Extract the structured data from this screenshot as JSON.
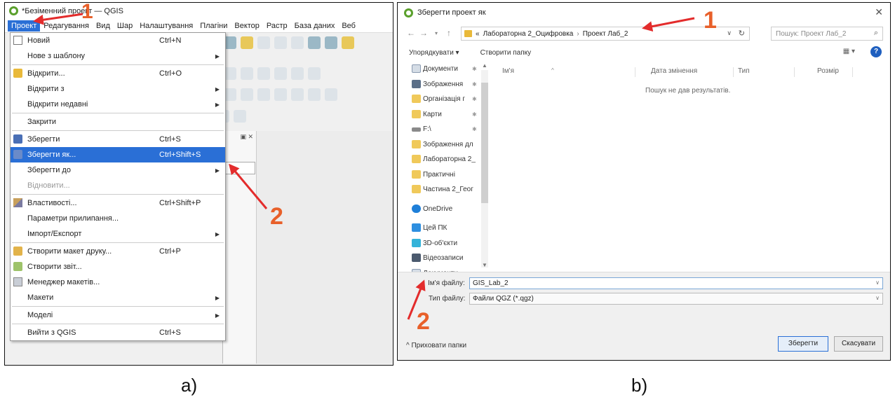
{
  "panel_a": {
    "window_title": "*Безіменний проект — QGIS",
    "menubar": [
      "Проект",
      "Редагування",
      "Вид",
      "Шар",
      "Налаштування",
      "Плагіни",
      "Вектор",
      "Растр",
      "База даних",
      "Веб"
    ],
    "menu_items": [
      {
        "label": "Новий",
        "shortcut": "Ctrl+N",
        "icon": "new-document-icon"
      },
      {
        "label": "Нове з шаблону",
        "submenu": true
      },
      {
        "separator": true
      },
      {
        "label": "Відкрити...",
        "shortcut": "Ctrl+O",
        "icon": "folder-icon"
      },
      {
        "label": "Відкрити з",
        "submenu": true
      },
      {
        "label": "Відкрити недавні",
        "submenu": true
      },
      {
        "separator": true
      },
      {
        "label": "Закрити"
      },
      {
        "separator": true
      },
      {
        "label": "Зберегти",
        "shortcut": "Ctrl+S",
        "icon": "save-icon"
      },
      {
        "label": "Зберегти як...",
        "shortcut": "Ctrl+Shift+S",
        "icon": "save-as-icon",
        "highlighted": true
      },
      {
        "label": "Зберегти до",
        "submenu": true
      },
      {
        "label": "Відновити...",
        "disabled": true
      },
      {
        "separator": true
      },
      {
        "label": "Властивості...",
        "shortcut": "Ctrl+Shift+P",
        "icon": "properties-icon"
      },
      {
        "label": "Параметри прилипання..."
      },
      {
        "label": "Імпорт/Експорт",
        "submenu": true
      },
      {
        "separator": true
      },
      {
        "label": "Створити макет друку...",
        "shortcut": "Ctrl+P",
        "icon": "print-layout-icon"
      },
      {
        "label": "Створити звіт...",
        "icon": "report-icon"
      },
      {
        "label": "Менеджер макетів...",
        "icon": "layout-manager-icon"
      },
      {
        "label": "Макети",
        "submenu": true
      },
      {
        "separator": true
      },
      {
        "label": "Моделі",
        "submenu": true
      },
      {
        "separator": true
      },
      {
        "label": "Вийти з QGIS",
        "shortcut": "Ctrl+S"
      }
    ],
    "caption": "a)",
    "annotation_1": "1",
    "annotation_2": "2"
  },
  "panel_b": {
    "window_title": "Зберегти проект як",
    "breadcrumb_prefix": "«",
    "breadcrumb": [
      "Лабораторна 2_Оцифровка",
      "Проект Лаб_2"
    ],
    "search_placeholder": "Пошук: Проект Лаб_2",
    "organize_label": "Упорядкувати ▾",
    "new_folder_label": "Створити папку",
    "nav_items": [
      {
        "label": "Документи",
        "icon": "documents-icon",
        "pin": true
      },
      {
        "label": "Зображення",
        "icon": "images-icon",
        "pin": true
      },
      {
        "label": "Організація г",
        "icon": "folder-icon",
        "pin": true
      },
      {
        "label": "Карти",
        "icon": "folder-icon",
        "pin": true
      },
      {
        "label": "F:\\",
        "icon": "drive-icon",
        "pin": true
      },
      {
        "label": "Зображення дл",
        "icon": "folder-icon"
      },
      {
        "label": "Лабораторна 2_",
        "icon": "folder-icon"
      },
      {
        "label": "Практичні",
        "icon": "folder-icon"
      },
      {
        "label": "Частина 2_Геог",
        "icon": "folder-icon"
      },
      {
        "gap": true
      },
      {
        "label": "OneDrive",
        "icon": "onedrive-icon"
      },
      {
        "gap": true
      },
      {
        "label": "Цей ПК",
        "icon": "this-pc-icon"
      },
      {
        "label": "3D-об'єкти",
        "icon": "3d-objects-icon"
      },
      {
        "label": "Відеозаписи",
        "icon": "videos-icon"
      },
      {
        "label": "Документи",
        "icon": "documents-icon"
      }
    ],
    "columns": [
      "Ім'я",
      "Дата змінення",
      "Тип",
      "Розмір"
    ],
    "empty_message": "Пошук не дав результатів.",
    "filename_label": "Ім'я файлу:",
    "filename_value": "GIS_Lab_2",
    "filetype_label": "Тип файлу:",
    "filetype_value": "Файли QGZ (*.qgz)",
    "hide_folders_label": "^ Приховати папки",
    "save_button": "Зберегти",
    "cancel_button": "Скасувати",
    "caption": "b)",
    "annotation_1": "1",
    "annotation_2": "2"
  },
  "colors": {
    "annotation_red": "#e32c2c",
    "annotation_orange": "#e8602a",
    "highlight_blue": "#2a6fd6"
  }
}
